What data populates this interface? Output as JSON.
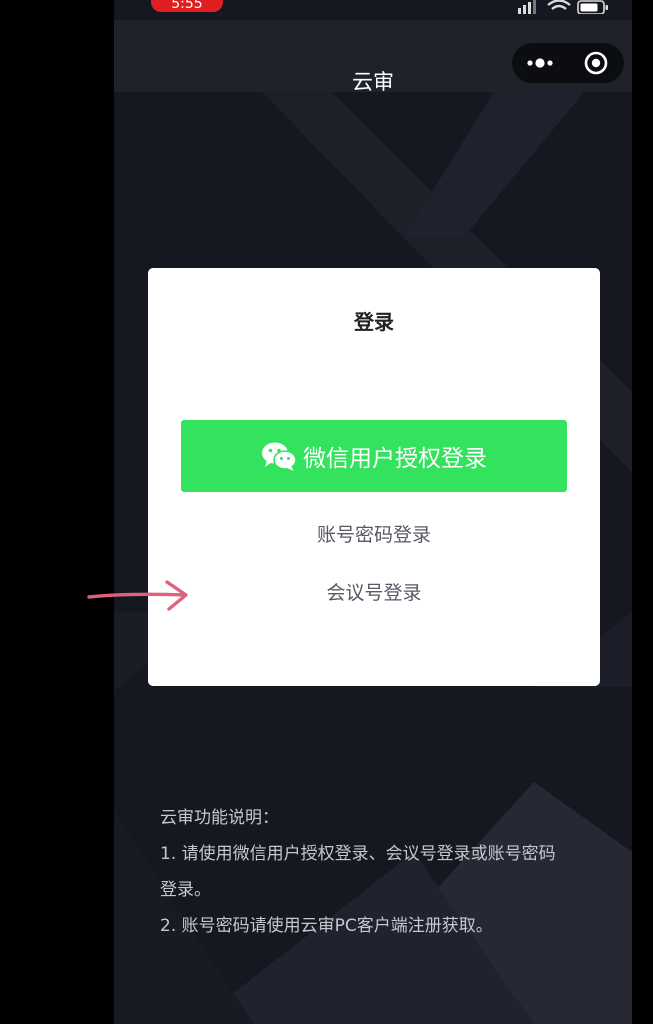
{
  "status_bar": {
    "time": "5:55"
  },
  "nav": {
    "title": "云审",
    "more_icon": "more-dots-icon",
    "close_icon": "target-circle-icon"
  },
  "login": {
    "title": "登录",
    "wechat_button_label": "微信用户授权登录",
    "wechat_icon": "wechat-icon",
    "account_login_label": "账号密码登录",
    "meeting_login_label": "会议号登录"
  },
  "info": {
    "heading": "云审功能说明：",
    "line1a": "1. 请使用微信用户授权登录、会议号登录或账号密码",
    "line1b": "登录。",
    "line2": "2. 账号密码请使用云审PC客户端注册获取。"
  },
  "colors": {
    "wechat_green": "#33e35e",
    "annotation_arrow": "#e0617a",
    "status_badge": "#e02020"
  }
}
